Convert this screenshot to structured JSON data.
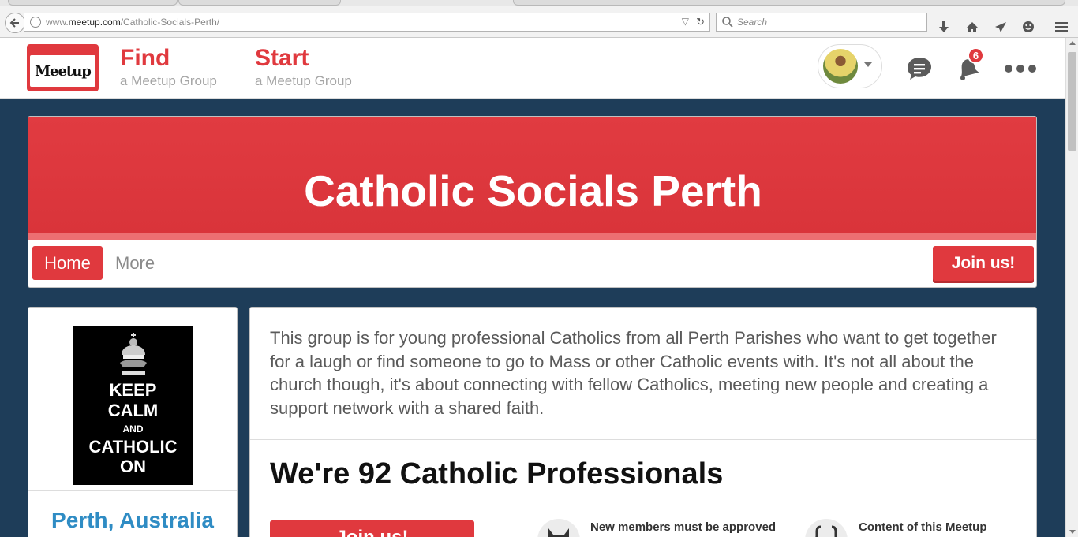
{
  "browser": {
    "url_prefix": "www.",
    "url_domain": "meetup.com",
    "url_path": "/Catholic-Socials-Perth/",
    "search_placeholder": "Search"
  },
  "header": {
    "logo_text": "Meetup",
    "find_label": "Find",
    "find_sub": "a Meetup Group",
    "start_label": "Start",
    "start_sub": "a Meetup Group",
    "notification_count": "6"
  },
  "group": {
    "name": "Catholic Socials Perth",
    "tabs": [
      {
        "label": "Home",
        "active": true
      },
      {
        "label": "More",
        "active": false
      }
    ],
    "join_label": "Join us!",
    "poster_lines": [
      "KEEP",
      "CALM",
      "AND",
      "CATHOLIC",
      "ON"
    ],
    "city": "Perth, Australia",
    "description": "This group is for young professional Catholics from all Perth Parishes who want to get together for a laugh or find someone to go to Mass or other Catholic events with. It's not all about the church though, it's about connecting with fellow Catholics, meeting new people and creating a support network with a shared faith.",
    "members_heading": "We're 92 Catholic Professionals",
    "join_bottom_label": "Join us!",
    "info": [
      {
        "icon": "approval-icon",
        "text": "New members must be approved"
      },
      {
        "icon": "content-icon",
        "text": "Content of this Meetup"
      }
    ]
  },
  "colors": {
    "brand_red": "#e0393e",
    "page_bg": "#1e3d59",
    "link_blue": "#2f8cc4"
  }
}
